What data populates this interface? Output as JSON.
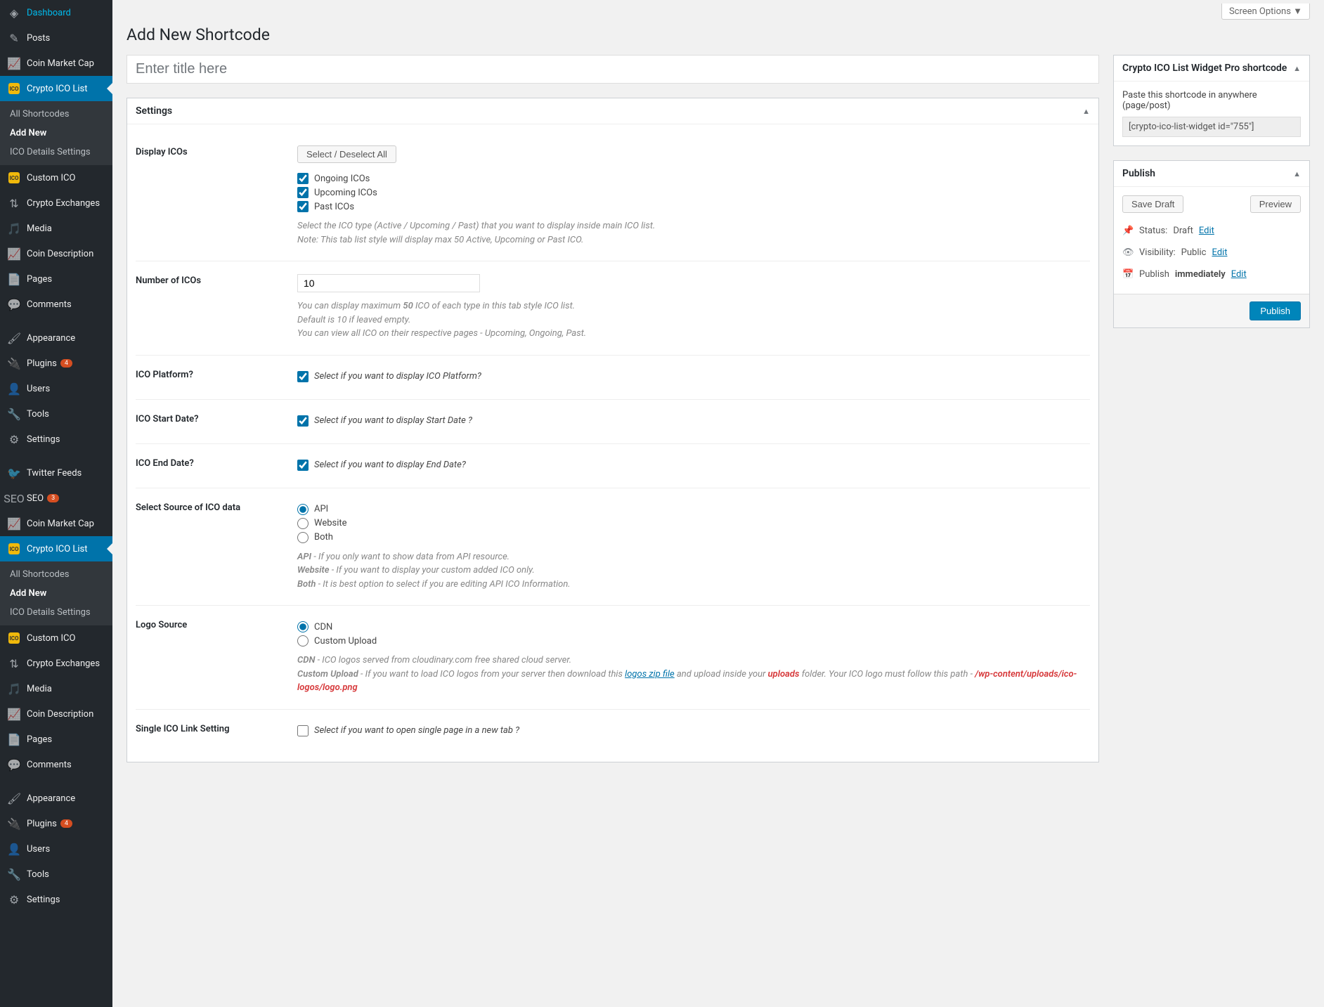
{
  "screen_options": "Screen Options ▼",
  "page_title": "Add New Shortcode",
  "title_placeholder": "Enter title here",
  "sidebar": {
    "items1": [
      {
        "icon": "dashboard",
        "label": "Dashboard"
      },
      {
        "icon": "posts",
        "label": "Posts"
      },
      {
        "icon": "chart",
        "label": "Coin Market Cap"
      }
    ],
    "crypto_label": "Crypto ICO List",
    "submenu": [
      {
        "label": "All Shortcodes",
        "current": false
      },
      {
        "label": "Add New",
        "current": true
      },
      {
        "label": "ICO Details Settings",
        "current": false
      }
    ],
    "items2": [
      {
        "icon": "ico",
        "label": "Custom ICO"
      },
      {
        "icon": "exchange",
        "label": "Crypto Exchanges"
      },
      {
        "icon": "media",
        "label": "Media"
      },
      {
        "icon": "chart",
        "label": "Coin Description"
      },
      {
        "icon": "page",
        "label": "Pages"
      },
      {
        "icon": "comment",
        "label": "Comments"
      }
    ],
    "items3": [
      {
        "icon": "appearance",
        "label": "Appearance"
      },
      {
        "icon": "plugin",
        "label": "Plugins",
        "badge": "4"
      },
      {
        "icon": "users",
        "label": "Users"
      },
      {
        "icon": "tools",
        "label": "Tools"
      },
      {
        "icon": "settings",
        "label": "Settings"
      }
    ],
    "items4": [
      {
        "icon": "twitter",
        "label": "Twitter Feeds"
      },
      {
        "icon": "seo",
        "label": "SEO",
        "badge": "3"
      },
      {
        "icon": "chart",
        "label": "Coin Market Cap"
      }
    ],
    "crypto_label2": "Crypto ICO List",
    "submenu2": [
      {
        "label": "All Shortcodes",
        "current": false
      },
      {
        "label": "Add New",
        "current": true
      },
      {
        "label": "ICO Details Settings",
        "current": false
      }
    ],
    "items5": [
      {
        "icon": "ico",
        "label": "Custom ICO"
      },
      {
        "icon": "exchange",
        "label": "Crypto Exchanges"
      },
      {
        "icon": "media",
        "label": "Media"
      },
      {
        "icon": "chart",
        "label": "Coin Description"
      },
      {
        "icon": "page",
        "label": "Pages"
      },
      {
        "icon": "comment",
        "label": "Comments"
      }
    ],
    "items6": [
      {
        "icon": "appearance",
        "label": "Appearance"
      },
      {
        "icon": "plugin",
        "label": "Plugins",
        "badge": "4"
      },
      {
        "icon": "users",
        "label": "Users"
      },
      {
        "icon": "tools",
        "label": "Tools"
      },
      {
        "icon": "settings",
        "label": "Settings"
      }
    ]
  },
  "settings": {
    "box_title": "Settings",
    "display_icos": {
      "label": "Display ICOs",
      "select_all": "Select / Deselect All",
      "ongoing": "Ongoing ICOs",
      "upcoming": "Upcoming ICOs",
      "past": "Past ICOs",
      "help1": "Select the ICO type (Active / Upcoming / Past) that you want to display inside main ICO list.",
      "help2": "Note: This tab list style will display max 50 Active, Upcoming or Past ICO."
    },
    "number": {
      "label": "Number of ICOs",
      "value": "10",
      "help1a": "You can display maximum ",
      "help1b": "50",
      "help1c": " ICO of each type in this tab style ICO list.",
      "help2": "Default is 10 if leaved empty.",
      "help3": "You can view all ICO on their respective pages - Upcoming, Ongoing, Past."
    },
    "platform": {
      "label": "ICO Platform?",
      "hint": "Select if you want to display ICO Platform?"
    },
    "start_date": {
      "label": "ICO Start Date?",
      "hint": "Select if you want to display Start Date ?"
    },
    "end_date": {
      "label": "ICO End Date?",
      "hint": "Select if you want to display End Date?"
    },
    "source": {
      "label": "Select Source of ICO data",
      "api": "API",
      "website": "Website",
      "both": "Both",
      "help_api_b": "API",
      "help_api": " - If you only want to show data from API resource.",
      "help_web_b": "Website",
      "help_web": " - If you want to display your custom added ICO only.",
      "help_both_b": "Both",
      "help_both": " - It is best option to select if you are editing API ICO Information."
    },
    "logo": {
      "label": "Logo Source",
      "cdn": "CDN",
      "upload": "Custom Upload",
      "help_cdn_b": "CDN",
      "help_cdn": " - ICO logos served from cloudinary.com free shared cloud server.",
      "help_up_b": "Custom Upload",
      "help_up_1": " - If you want to load ICO logos from your server then download this ",
      "help_up_link": "logos zip file",
      "help_up_2": " and upload inside your ",
      "help_up_red1": "uploads",
      "help_up_3": " folder. Your ICO logo must follow this path - ",
      "help_up_red2": "/wp-content/uploads/ico-logos/logo.png"
    },
    "single_link": {
      "label": "Single ICO Link Setting",
      "hint": "Select if you want to open single page in a new tab ?"
    }
  },
  "widget_box": {
    "title": "Crypto ICO List Widget Pro shortcode",
    "desc": "Paste this shortcode in anywhere (page/post)",
    "code": "[crypto-ico-list-widget id=\"755\"]"
  },
  "publish": {
    "title": "Publish",
    "save_draft": "Save Draft",
    "preview": "Preview",
    "status_label": "Status:",
    "status_value": "Draft",
    "visibility_label": "Visibility:",
    "visibility_value": "Public",
    "publish_label": "Publish",
    "publish_value": "immediately",
    "edit": "Edit",
    "publish_btn": "Publish"
  }
}
